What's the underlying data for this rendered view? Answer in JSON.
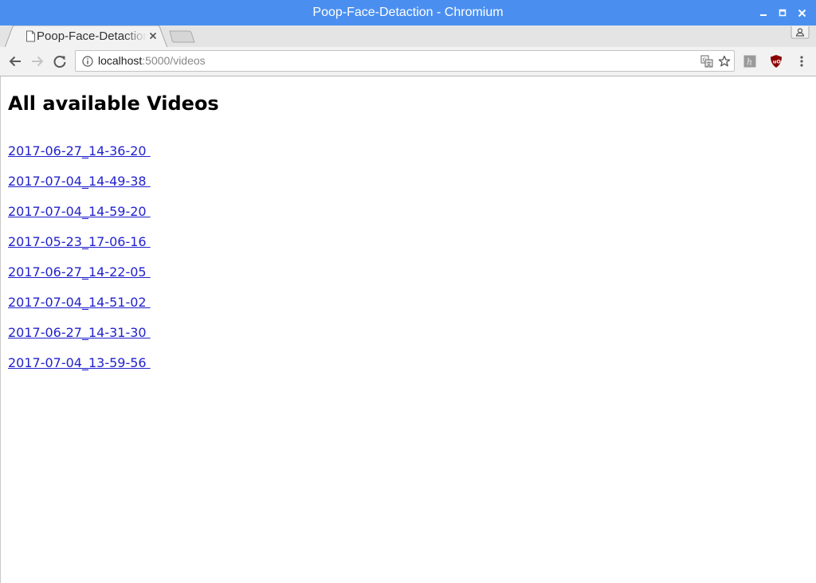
{
  "window": {
    "title": "Poop-Face-Detaction - Chromium"
  },
  "tab": {
    "title": "Poop-Face-Detaction"
  },
  "toolbar": {
    "url_host": "localhost",
    "url_path": ":5000/videos"
  },
  "page": {
    "heading": "All available Videos",
    "videos": [
      "2017-06-27_14-36-20 ",
      "2017-07-04_14-49-38 ",
      "2017-07-04_14-59-20 ",
      "2017-05-23_17-06-16 ",
      "2017-06-27_14-22-05 ",
      "2017-07-04_14-51-02 ",
      "2017-06-27_14-31-30 ",
      "2017-07-04_13-59-56 "
    ]
  },
  "colors": {
    "titlebar": "#4a8ff0",
    "link": "#2222cc",
    "ublock_red": "#8b0000"
  },
  "icons": {
    "minimize": "minimize-icon",
    "maximize": "maximize-icon",
    "close": "close-icon",
    "back": "back-arrow-icon",
    "forward": "forward-arrow-icon",
    "reload": "reload-icon",
    "info": "info-icon",
    "translate": "translate-icon",
    "star": "star-icon",
    "extension_h": "h-extension-icon",
    "ublock": "ublock-origin-icon",
    "menu": "kebab-menu-icon",
    "profile": "profile-icon",
    "page": "page-favicon-icon"
  }
}
